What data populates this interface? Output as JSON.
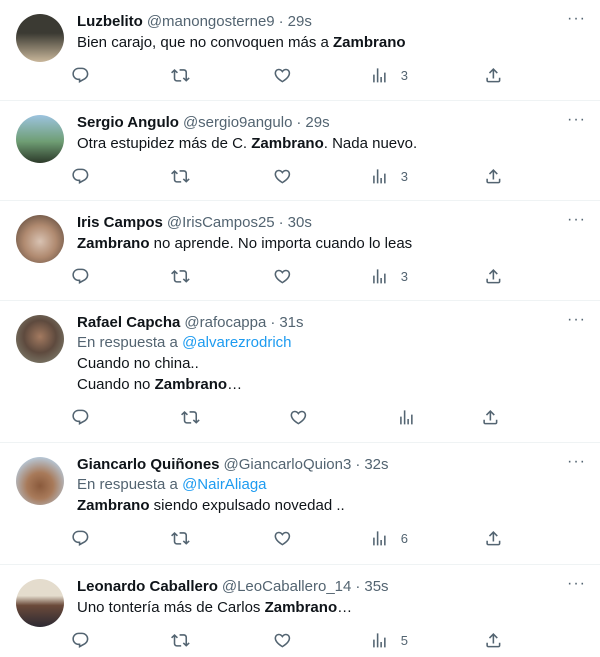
{
  "tweets": [
    {
      "name": "Luzbelito",
      "handle": "@manongosterne9",
      "time": "29s",
      "reply_prefix": "",
      "reply_to": "",
      "lines": [
        {
          "a": "Bien carajo, que no convoquen más a ",
          "b": "Zambrano",
          "c": ""
        }
      ],
      "views": "3",
      "avatar_colors": [
        "#3b3a33",
        "#c9b79b"
      ]
    },
    {
      "name": "Sergio Angulo",
      "handle": "@sergio9angulo",
      "time": "29s",
      "reply_prefix": "",
      "reply_to": "",
      "lines": [
        {
          "a": "Otra estupidez más de C. ",
          "b": "Zambrano",
          "c": ". Nada nuevo."
        }
      ],
      "views": "3",
      "avatar_colors": [
        "#6f9e74",
        "#2c3a2a"
      ]
    },
    {
      "name": "Iris Campos",
      "handle": "@IrisCampos25",
      "time": "30s",
      "reply_prefix": "",
      "reply_to": "",
      "lines": [
        {
          "a": "",
          "b": "Zambrano",
          "c": " no aprende. No importa cuando lo leas"
        }
      ],
      "views": "3",
      "avatar_colors": [
        "#d8c2b2",
        "#4a3a30"
      ]
    },
    {
      "name": "Rafael Capcha",
      "handle": "@rafocappa",
      "time": "31s",
      "reply_prefix": "En respuesta a ",
      "reply_to": "@alvarezrodrich",
      "lines": [
        {
          "a": "Cuando no china..",
          "b": "",
          "c": ""
        },
        {
          "a": "Cuando no ",
          "b": "Zambrano",
          "c": "…"
        }
      ],
      "views": "",
      "avatar_colors": [
        "#8a8f7d",
        "#3a2f2a"
      ]
    },
    {
      "name": "Giancarlo Quiñones",
      "handle": "@GiancarloQuion3",
      "time": "32s",
      "reply_prefix": "En respuesta a ",
      "reply_to": "@NairAliaga",
      "lines": [
        {
          "a": "",
          "b": "Zambrano",
          "c": " siendo expulsado novedad .."
        }
      ],
      "views": "6",
      "avatar_colors": [
        "#b8cde0",
        "#8a5a3c"
      ]
    },
    {
      "name": "Leonardo Caballero",
      "handle": "@LeoCaballero_14",
      "time": "35s",
      "reply_prefix": "",
      "reply_to": "",
      "lines": [
        {
          "a": "Uno tontería más de Carlos ",
          "b": "Zambrano",
          "c": "…"
        }
      ],
      "views": "5",
      "avatar_colors": [
        "#e4dccd",
        "#2d2a33"
      ]
    }
  ]
}
